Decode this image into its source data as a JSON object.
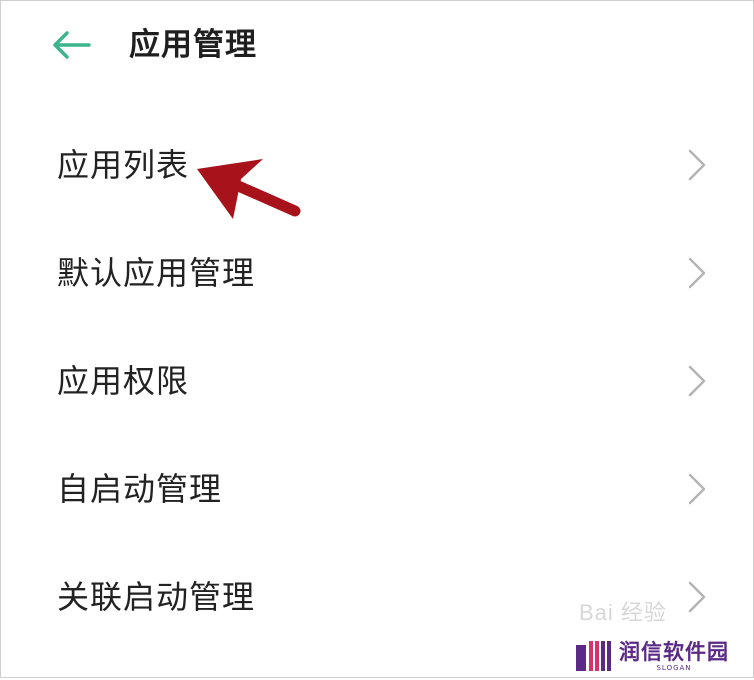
{
  "header": {
    "title": "应用管理",
    "back_icon": "arrow-left-icon",
    "accent_color": "#3cb48c"
  },
  "menu": {
    "items": [
      {
        "label": "应用列表",
        "icon": "chevron-right-icon"
      },
      {
        "label": "默认应用管理",
        "icon": "chevron-right-icon"
      },
      {
        "label": "应用权限",
        "icon": "chevron-right-icon"
      },
      {
        "label": "自启动管理",
        "icon": "chevron-right-icon"
      },
      {
        "label": "关联启动管理",
        "icon": "chevron-right-icon"
      }
    ]
  },
  "annotation": {
    "icon": "red-arrow-icon",
    "color": "#a8121b"
  },
  "watermark": {
    "faded_text": "Bai 经验",
    "logo_text": "润信软件园",
    "logo_slogan": "SLOGAN",
    "logo_color": "#5b2a86"
  }
}
